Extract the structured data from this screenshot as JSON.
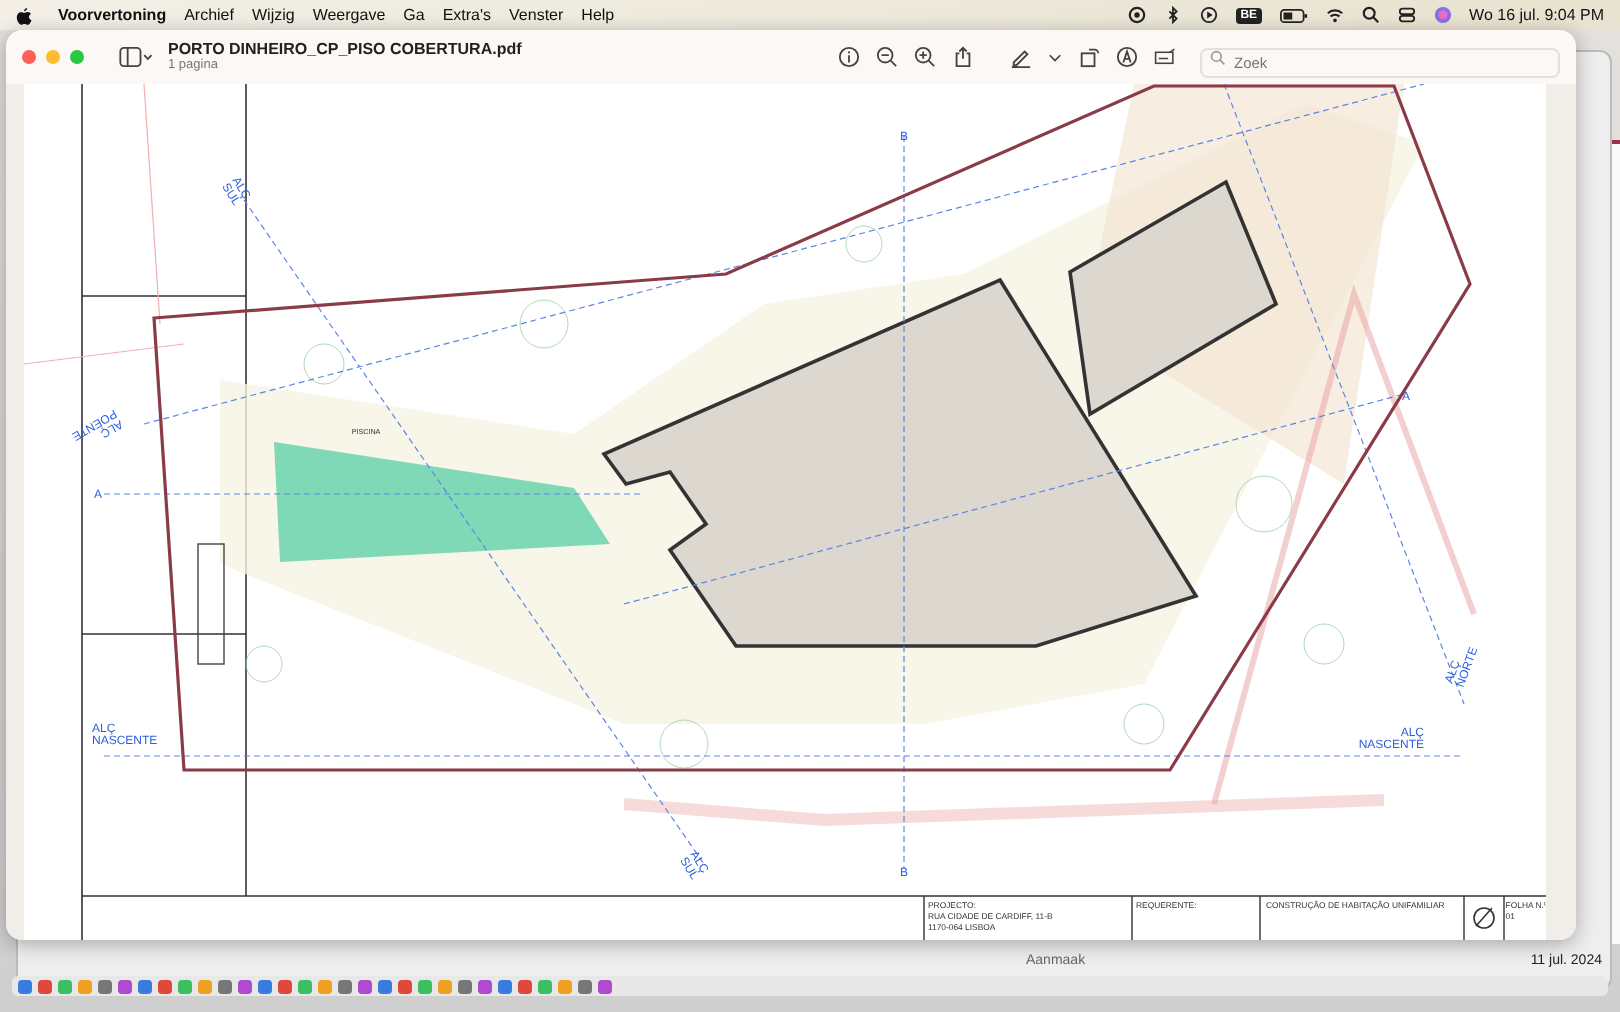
{
  "menubar": {
    "app": "Voorvertoning",
    "menus": [
      "Archief",
      "Wijzig",
      "Weergave",
      "Ga",
      "Extra's",
      "Venster",
      "Help"
    ],
    "input_source": "BE",
    "clock": "Wo 16 jul.  9:04 PM"
  },
  "window": {
    "title": "PORTO DINHEIRO_CP_PISO COBERTURA.pdf",
    "subtitle": "1 pagina",
    "search": {
      "placeholder": "Zoek"
    }
  },
  "drawing": {
    "labels": [
      {
        "kind": "section",
        "lines": [
          "ALÇ",
          "SUL"
        ]
      },
      {
        "kind": "section",
        "lines": [
          "ALÇ",
          "POENTE"
        ]
      },
      {
        "kind": "section",
        "lines": [
          "A"
        ]
      },
      {
        "kind": "section",
        "lines": [
          "ALÇ",
          "NASCENTE"
        ]
      },
      {
        "kind": "section",
        "lines": [
          "B"
        ]
      },
      {
        "kind": "section",
        "lines": [
          "A"
        ]
      },
      {
        "kind": "section",
        "lines": [
          "ALÇ",
          "NORTE"
        ]
      },
      {
        "kind": "section",
        "lines": [
          "ALÇ",
          "NASCENTE"
        ]
      },
      {
        "kind": "section",
        "lines": [
          "ALÇ",
          "SUL"
        ]
      },
      {
        "kind": "section",
        "lines": [
          "B"
        ]
      },
      {
        "kind": "area",
        "lines": [
          "PISCINA"
        ]
      }
    ],
    "title_block": [
      {
        "lines": [
          "PROJECTO:",
          "RUA CIDADE DE CARDIFF, 11-B",
          "1170-064 LISBOA"
        ]
      },
      {
        "lines": [
          "REQUERENTE:"
        ]
      },
      {
        "lines": [
          "CONSTRUÇÃO DE HABITAÇÃO UNIFAMILIAR"
        ]
      },
      {
        "lines": [
          "FOLHA N.º",
          "01"
        ]
      }
    ]
  },
  "background_window": {
    "column_1": "Aanmaak",
    "column_2": "11 jul. 2024"
  }
}
